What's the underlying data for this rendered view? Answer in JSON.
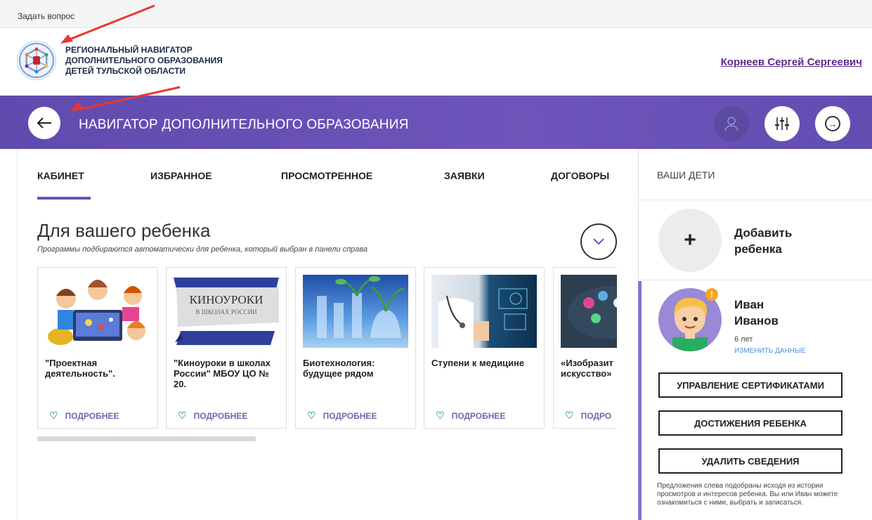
{
  "topbar": {
    "ask_label": "Задать вопрос"
  },
  "header": {
    "org_line1": "РЕГИОНАЛЬНЫЙ НАВИГАТОР",
    "org_line2": "ДОПОЛНИТЕЛЬНОГО ОБРАЗОВАНИЯ",
    "org_line3": "ДЕТЕЙ ТУЛЬСКОЙ ОБЛАСТИ",
    "user_name": "Корнеев Сергей Сергеевич"
  },
  "navbar": {
    "title": "НАВИГАТОР ДОПОЛНИТЕЛЬНОГО ОБРАЗОВАНИЯ"
  },
  "tabs": [
    {
      "label": "КАБИНЕТ",
      "active": true
    },
    {
      "label": "ИЗБРАННОЕ"
    },
    {
      "label": "ПРОСМОТРЕННОЕ"
    },
    {
      "label": "ЗАЯВКИ"
    },
    {
      "label": "ДОГОВОРЫ"
    }
  ],
  "section": {
    "title": "Для вашего ребенка",
    "subtitle": "Программы подбираются автоматически для ребенка, который выбран в панели справа"
  },
  "cards": [
    {
      "title": "\"Проектная деятельность\".",
      "more": "ПОДРОБНЕЕ"
    },
    {
      "title": "\"Киноуроки в школах России\" МБОУ ЦО № 20.",
      "more": "ПОДРОБНЕЕ",
      "img_text1": "КИНОУРОКИ",
      "img_text2": "В ШКОЛАХ РОССИИ"
    },
    {
      "title": "Биотехнология: будущее рядом",
      "more": "ПОДРОБНЕЕ"
    },
    {
      "title": "Ступени к медицине",
      "more": "ПОДРОБНЕЕ"
    },
    {
      "title": "«Изобразит искусство»",
      "more": "ПОДРО"
    }
  ],
  "sidebar": {
    "header": "ВАШИ ДЕТИ",
    "add_child": "Добавить ребенка",
    "child": {
      "first_name": "Иван",
      "last_name": "Иванов",
      "age": "6 лет",
      "edit": "ИЗМЕНИТЬ ДАННЫЕ"
    },
    "buttons": [
      "УПРАВЛЕНИЕ СЕРТИФИКАТАМИ",
      "ДОСТИЖЕНИЯ РЕБЕНКА",
      "УДАЛИТЬ СВЕДЕНИЯ"
    ],
    "note": "Предложения слева подобраны исходя из истории просмотров и интересов ребенка. Вы или Иван можете ознакомиться с ними, выбрать и записаться."
  },
  "colors": {
    "accent": "#6a52b7",
    "link": "#5b2c8c",
    "heart": "#4caf7d",
    "annotation_arrow": "#e53935"
  }
}
